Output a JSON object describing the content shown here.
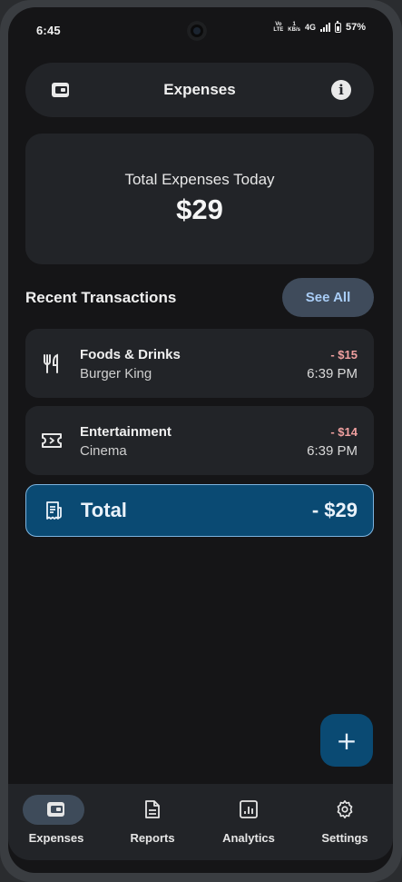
{
  "status_bar": {
    "time": "6:45",
    "volte_top": "Vo",
    "volte_bottom": "LTE",
    "speed_top": "1",
    "speed_bottom": "KB/s",
    "network": "4G",
    "battery": "57%"
  },
  "header": {
    "title": "Expenses",
    "left_icon": "wallet-icon",
    "right_icon": "info-icon",
    "info_glyph": "i"
  },
  "summary": {
    "label": "Total Expenses Today",
    "amount": "$29"
  },
  "recent": {
    "title": "Recent Transactions",
    "see_all_label": "See All"
  },
  "transactions": [
    {
      "icon": "fork-knife-icon",
      "category": "Foods & Drinks",
      "merchant": "Burger King",
      "amount": "- $15",
      "time": "6:39 PM"
    },
    {
      "icon": "ticket-icon",
      "category": "Entertainment",
      "merchant": "Cinema",
      "amount": "- $14",
      "time": "6:39 PM"
    }
  ],
  "total": {
    "icon": "receipt-icon",
    "label": "Total",
    "amount": "- $29"
  },
  "fab": {
    "icon": "plus-icon",
    "glyph": "+"
  },
  "bottom_nav": {
    "active": "Expenses",
    "items": [
      {
        "label": "Expenses",
        "icon": "wallet-icon"
      },
      {
        "label": "Reports",
        "icon": "document-icon"
      },
      {
        "label": "Analytics",
        "icon": "chart-icon"
      },
      {
        "label": "Settings",
        "icon": "gear-icon"
      }
    ]
  },
  "colors": {
    "background": "#151517",
    "card": "#222428",
    "accent": "#0a4a73",
    "accent_border": "#7db4df",
    "negative_amount": "#f0a0a0",
    "see_all_bg": "#3f4b5b",
    "see_all_text": "#a9cdf6"
  }
}
